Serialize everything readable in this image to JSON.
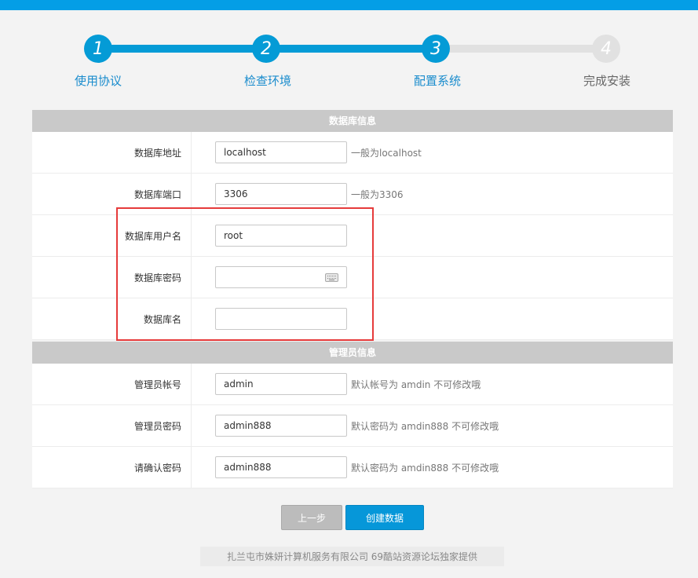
{
  "steps": [
    {
      "num": "1",
      "label": "使用协议",
      "state": "done"
    },
    {
      "num": "2",
      "label": "检查环境",
      "state": "done"
    },
    {
      "num": "3",
      "label": "配置系统",
      "state": "done"
    },
    {
      "num": "4",
      "label": "完成安装",
      "state": "todo"
    }
  ],
  "db_section": {
    "title": "数据库信息",
    "fields": [
      {
        "label": "数据库地址",
        "value": "localhost",
        "hint": "一般为localhost"
      },
      {
        "label": "数据库端口",
        "value": "3306",
        "hint": "一般为3306"
      },
      {
        "label": "数据库用户名",
        "value": "root",
        "hint": ""
      },
      {
        "label": "数据库密码",
        "value": "",
        "hint": ""
      },
      {
        "label": "数据库名",
        "value": "",
        "hint": ""
      }
    ]
  },
  "admin_section": {
    "title": "管理员信息",
    "fields": [
      {
        "label": "管理员帐号",
        "value": "admin",
        "hint": "默认帐号为 amdin 不可修改哦"
      },
      {
        "label": "管理员密码",
        "value": "admin888",
        "hint": "默认密码为 amdin888 不可修改哦"
      },
      {
        "label": "请确认密码",
        "value": "admin888",
        "hint": "默认密码为 amdin888 不可修改哦"
      }
    ]
  },
  "buttons": {
    "prev": "上一步",
    "create": "创建数据"
  },
  "footer": "扎兰屯市姝妍计算机服务有限公司 69酷站资源论坛独家提供",
  "colors": {
    "accent": "#049bd6",
    "inactive": "#e1e1e1",
    "highlight": "#e63b3b"
  }
}
